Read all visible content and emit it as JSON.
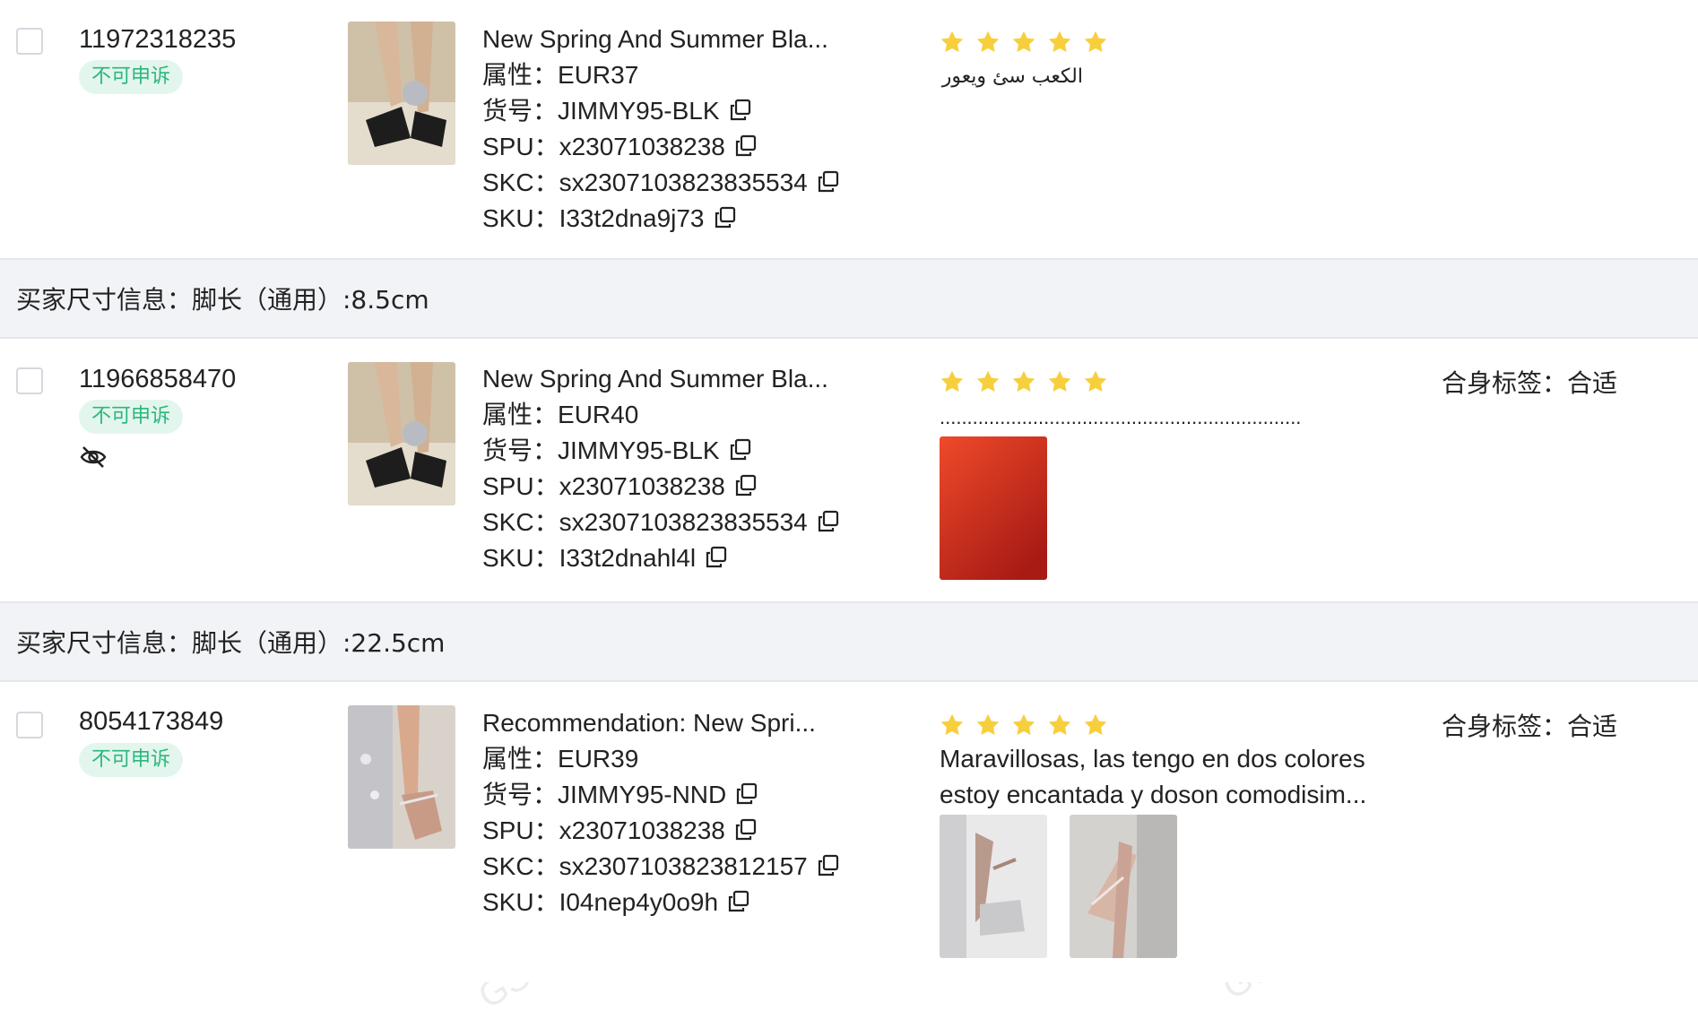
{
  "size_bar_label": "买家尺寸信息：",
  "rows": [
    {
      "order_id": "11972318235",
      "badge": "不可申诉",
      "title": "New Spring And Summer Bla...",
      "attr_label": "属性：",
      "attr": "EUR37",
      "item_no_label": "货号：",
      "item_no": "JIMMY95-BLK",
      "spu_label": "SPU：",
      "spu": "x23071038238",
      "skc_label": "SKC：",
      "skc": "sx2307103823835534",
      "sku_label": "SKU：",
      "sku": "I33t2dna9j73",
      "rating": 5,
      "review": "الكعب سئ ويعور",
      "fit": ""
    },
    {
      "order_id": "11966858470",
      "badge": "不可申诉",
      "title": "New Spring And Summer Bla...",
      "attr_label": "属性：",
      "attr": "EUR40",
      "item_no_label": "货号：",
      "item_no": "JIMMY95-BLK",
      "spu_label": "SPU：",
      "spu": "x23071038238",
      "skc_label": "SKC：",
      "skc": "sx2307103823835534",
      "sku_label": "SKU：",
      "sku": "I33t2dnahl4l",
      "rating": 5,
      "review": "..................................................................",
      "fit": "合身标签：合适"
    },
    {
      "order_id": "8054173849",
      "badge": "不可申诉",
      "title": "Recommendation: New Spri...",
      "attr_label": "属性：",
      "attr": "EUR39",
      "item_no_label": "货号：",
      "item_no": "JIMMY95-NND",
      "spu_label": "SPU：",
      "spu": "x23071038238",
      "skc_label": "SKC：",
      "skc": "sx2307103823812157",
      "sku_label": "SKU：",
      "sku": "I04nep4y0o9h",
      "rating": 5,
      "review": "Maravillosas, las tengo en dos colores",
      "review_line2": "estoy encantada y doson comodisim...",
      "fit": "合身标签：合适"
    }
  ],
  "size_bars": [
    "买家尺寸信息：脚长（通用）:8.5cm",
    "买家尺寸信息：脚长（通用）:22.5cm"
  ],
  "watermarks": [
    "2394457 1146256\nGSP 2024-09-04 10:48:28",
    "2394457 1146256\nGSP 2024-09-04 10:48:28",
    "2394457 1146256\nGSP 2024-09-04 10:48:28",
    "2394457 1146256\nGSP 2024-09-04 10:48:28"
  ],
  "colors": {
    "badge_text": "#2bb77c",
    "badge_bg": "#e3f6ee",
    "star": "#f7cf3d",
    "size_bar_bg": "#f2f3f6"
  },
  "icons": [
    "copy-icon",
    "star-icon",
    "eye-off-icon",
    "checkbox"
  ]
}
